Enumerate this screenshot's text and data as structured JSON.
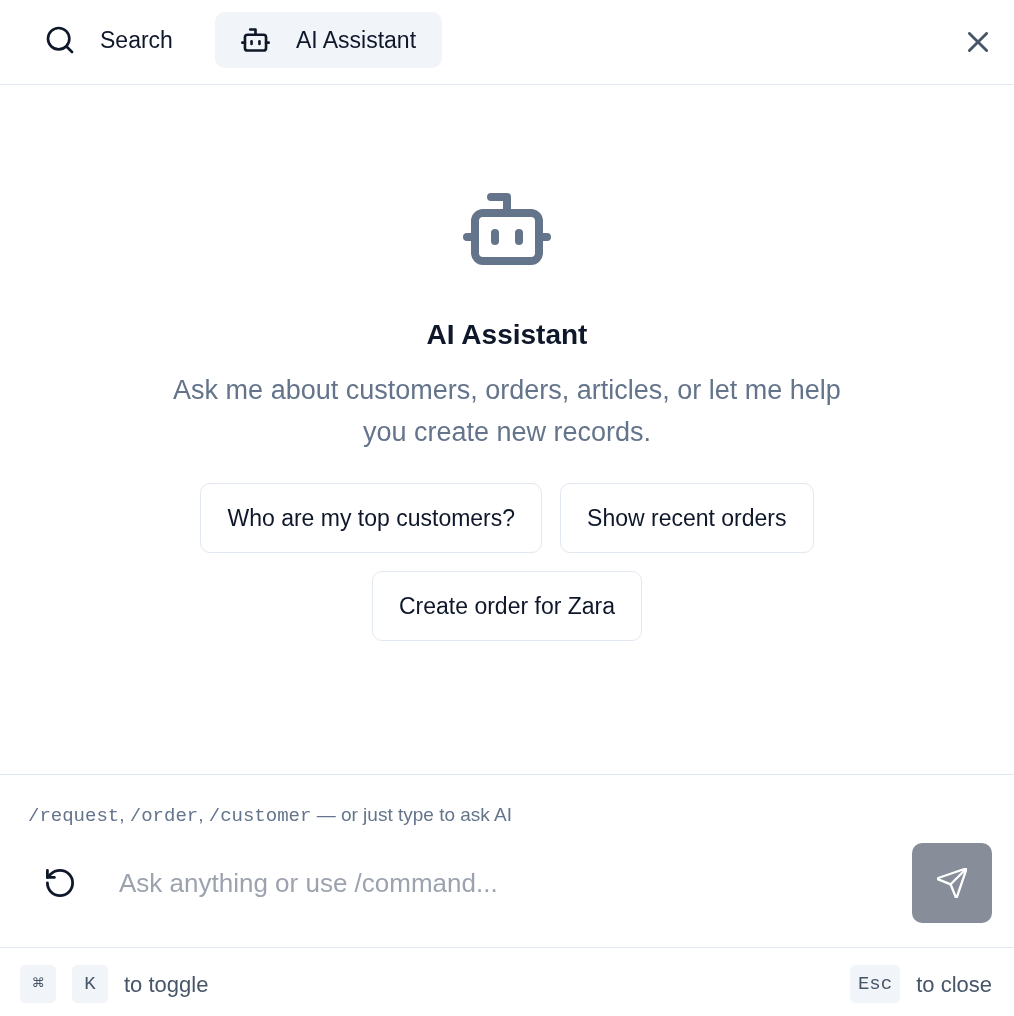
{
  "tabs": [
    {
      "label": "Search",
      "selected": false
    },
    {
      "label": "AI Assistant",
      "selected": true
    }
  ],
  "empty_state": {
    "title": "AI Assistant",
    "description": "Ask me about customers, orders, articles, or let me help you create new records.",
    "suggestions": [
      "Who are my top customers?",
      "Show recent orders",
      "Create order for Zara"
    ]
  },
  "composer": {
    "hint": [
      {
        "kind": "code",
        "text": "/request"
      },
      {
        "kind": "text",
        "text": ", "
      },
      {
        "kind": "code",
        "text": "/order"
      },
      {
        "kind": "text",
        "text": ", "
      },
      {
        "kind": "code",
        "text": "/customer"
      },
      {
        "kind": "text",
        "text": " — or just type to ask AI"
      }
    ],
    "placeholder": "Ask anything or use /command...",
    "send_disabled": true
  },
  "footer": {
    "left": {
      "keys": [
        "⌘",
        "K"
      ],
      "text": "to toggle"
    },
    "right": {
      "keys": [
        "Esc"
      ],
      "text": "to close"
    }
  }
}
